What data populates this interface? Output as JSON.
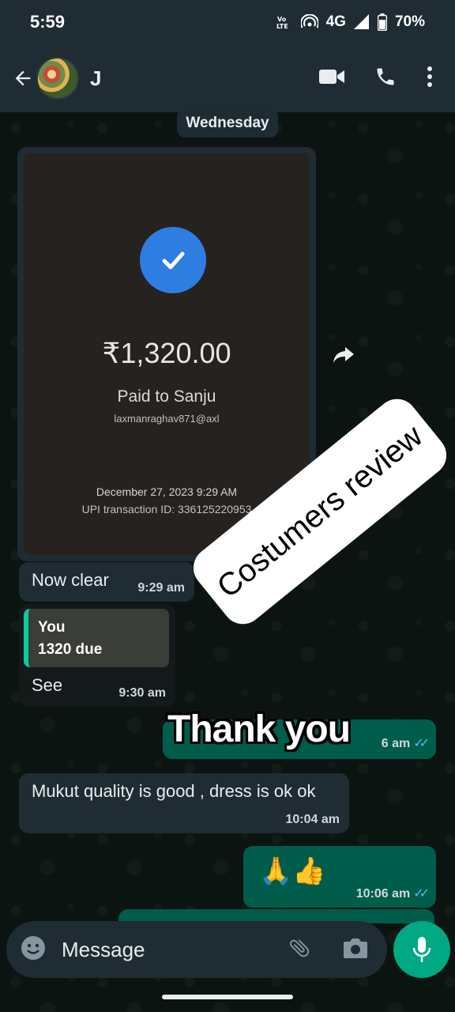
{
  "status_bar": {
    "time": "5:59",
    "volte": "Vo LTE",
    "network": "4G",
    "battery": "70%"
  },
  "header": {
    "contact_name": "J"
  },
  "chat": {
    "date_chip": "Wednesday",
    "payment": {
      "amount": "₹1,320.00",
      "paid_to": "Paid to Sanju",
      "upi_id": "laxmanraghav871@axl",
      "date": "December 27, 2023 9:29 AM",
      "txn_id": "UPI transaction ID: 336125220953"
    },
    "messages": [
      {
        "text": "Now clear",
        "time": "9:29 am"
      },
      {
        "quote_author": "You",
        "quote_text": "1320 due",
        "text": "See",
        "time": "9:30 am"
      },
      {
        "text": "",
        "time": "6 am"
      },
      {
        "text": "Mukut quality is good , dress is ok ok",
        "time": "10:04 am"
      },
      {
        "text": "🙏👍",
        "time": "10:06 am"
      }
    ],
    "overlay_thank_you": "Thank you",
    "watermark": "Costumers review"
  },
  "input": {
    "placeholder": "Message"
  },
  "colors": {
    "header_bg": "#1f2c34",
    "incoming_bubble": "#1f2c34",
    "outgoing_bubble": "#005c4b",
    "accent": "#00a884",
    "read_ticks": "#53bdeb"
  }
}
